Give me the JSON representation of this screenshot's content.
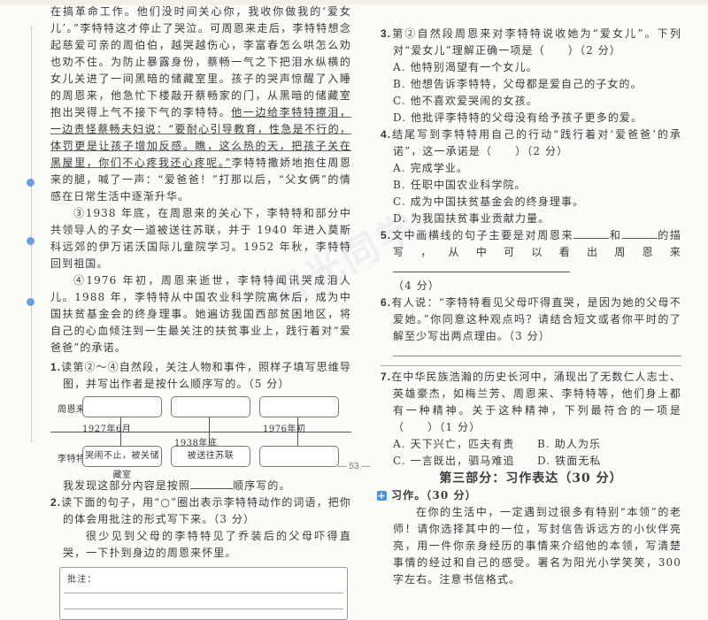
{
  "passage": {
    "p1_before": "在搞革命工作。他们没时间关心你，我收你做我的‘爱女儿’。”李特特这才停止了哭泣。可周恩来走后，李特特想念起慈爱可亲的周伯伯，越哭越伤心，李富春怎么哄怎么劝也劝不住。为防止暴露身份，蔡畅一气之下把泪水纵横的女儿关进了一间黑暗的储藏室里。孩子的哭声惊醒了入睡的周恩来，他急忙下楼敲开蔡畅家的门，从黑暗的储藏室抱出哭得上气不接下气的李特特。",
    "p1_underlined": "他一边给李特特擦泪，一边责怪蔡畅夫妇说：“要耐心引导教育，性急是不行的，体罚更是让孩子增加反感。瞧，这么热的天，把孩子关在黑屋里，你们不心疼我还心疼呢。”",
    "p1_after": "李特特撒娇地抱住周恩来的腿，喊了一声：“爱爸爸！”打那以后，“父女俩”的情感在日常生活中逐渐升华。",
    "p3": "③1938 年底，在周恩来的关心下，李特特和部分中共领导人的子女一道被送往苏联，并于 1940 年进入莫斯科远郊的伊万诺沃国际儿童院学习。1952 年秋，李特特回到祖国。",
    "p4": "④1976 年初，周恩来逝世，李特特闻讯哭成泪人儿。1988 年，李特特从中国农业科学院离休后，成为中国扶贫基金会的终身理事。她遍访我国西部贫困地区，将自己的心血倾注到一生最关注的扶贫事业上，践行着对“爱爸爸”的承诺。"
  },
  "q1": {
    "num": "1.",
    "text": "读第②～④自然段，关注人物和事件，照样子填写思维导图，并写出作者是按什么顺序写的。（5 分）",
    "row1_label": "周恩来",
    "row2_label": "李特特",
    "date1": "1927年6月",
    "date2": "1938年底",
    "date3": "1976年初",
    "box_b1": "哭闹不止，被关储藏室",
    "box_b2": "被送往苏联",
    "finding_before": "我发现这部分内容是按照",
    "finding_after": "顺序写的。"
  },
  "q2": {
    "num": "2.",
    "text": "读下面的句子，用“○”圈出表示李特特动作的词语，把你的体会用批注的形式写下来。（3 分）",
    "sentence": "很少见到父母的李特特见了乔装后的父母吓得直哭，一下扑到身边的周恩来怀里。",
    "anno_label": "批注："
  },
  "q3": {
    "num": "3.",
    "text": "第②自然段周恩来对李特特说收她为“爱女儿”。下列对“爱女儿”理解正确一项是（　　）（2 分）",
    "options": [
      "A. 他特别渴望有一个女儿。",
      "B. 他想告诉李特特，父母都是爱自己的子女的。",
      "C. 他不喜欢爱哭闹的女孩。",
      "D. 他批评李特特的父母没有给予孩子更多的爱。"
    ]
  },
  "q4": {
    "num": "4.",
    "text": "结尾写到李特特用自己的行动“践行着对‘爱爸爸’的承诺”，这一承诺是（　　）（2 分）",
    "options": [
      "A. 完成学业。",
      "B. 任职中国农业科学院。",
      "C. 成为中国扶贫基金会的终身理事。",
      "D. 为我国扶贫事业贡献力量。"
    ]
  },
  "q5": {
    "num": "5.",
    "text_a": "文中画横线的句子主要是对周恩来",
    "text_b": "和",
    "text_c": "的描写，从中可以看出周恩来",
    "score": "（4 分）"
  },
  "q6": {
    "num": "6.",
    "text": "有人说：“李特特看见父母吓得直哭，是因为她的父母不爱她。”你同意这种观点吗？请结合短文或者你平时的了解至少写出两点理由。（3 分）"
  },
  "q7": {
    "num": "7.",
    "text": "在中华民族浩瀚的历史长河中，涌现出了无数仁人志士、英雄豪杰，如梅兰芳、周恩来、李特特等，他们身上都有一种精神。关于这种精神，下列最符合的一项是（　　）（1 分）",
    "options": [
      "A. 天下兴亡，匹夫有责",
      "B. 助人为乐",
      "C. 一言既出，驷马难追",
      "D. 铁面无私"
    ]
  },
  "section3": {
    "title": "第三部分：习作表达（30 分）",
    "task_label": "习作。（30 分）",
    "prompt": "在你的生活中，一定遇到过很多有特别“本领”的老师！请你选择其中的一位，写封信告诉远方的小伙伴亮亮，用一件你亲身经历的事情来介绍他的本领，写清楚事情的经过和自己的感受。署名为阳光小学笑笑，300 字左右。注意书信格式。"
  },
  "page_number": "— 53 —",
  "watermark": "阳光同学",
  "colors": {
    "accent": "#4a90e0"
  }
}
